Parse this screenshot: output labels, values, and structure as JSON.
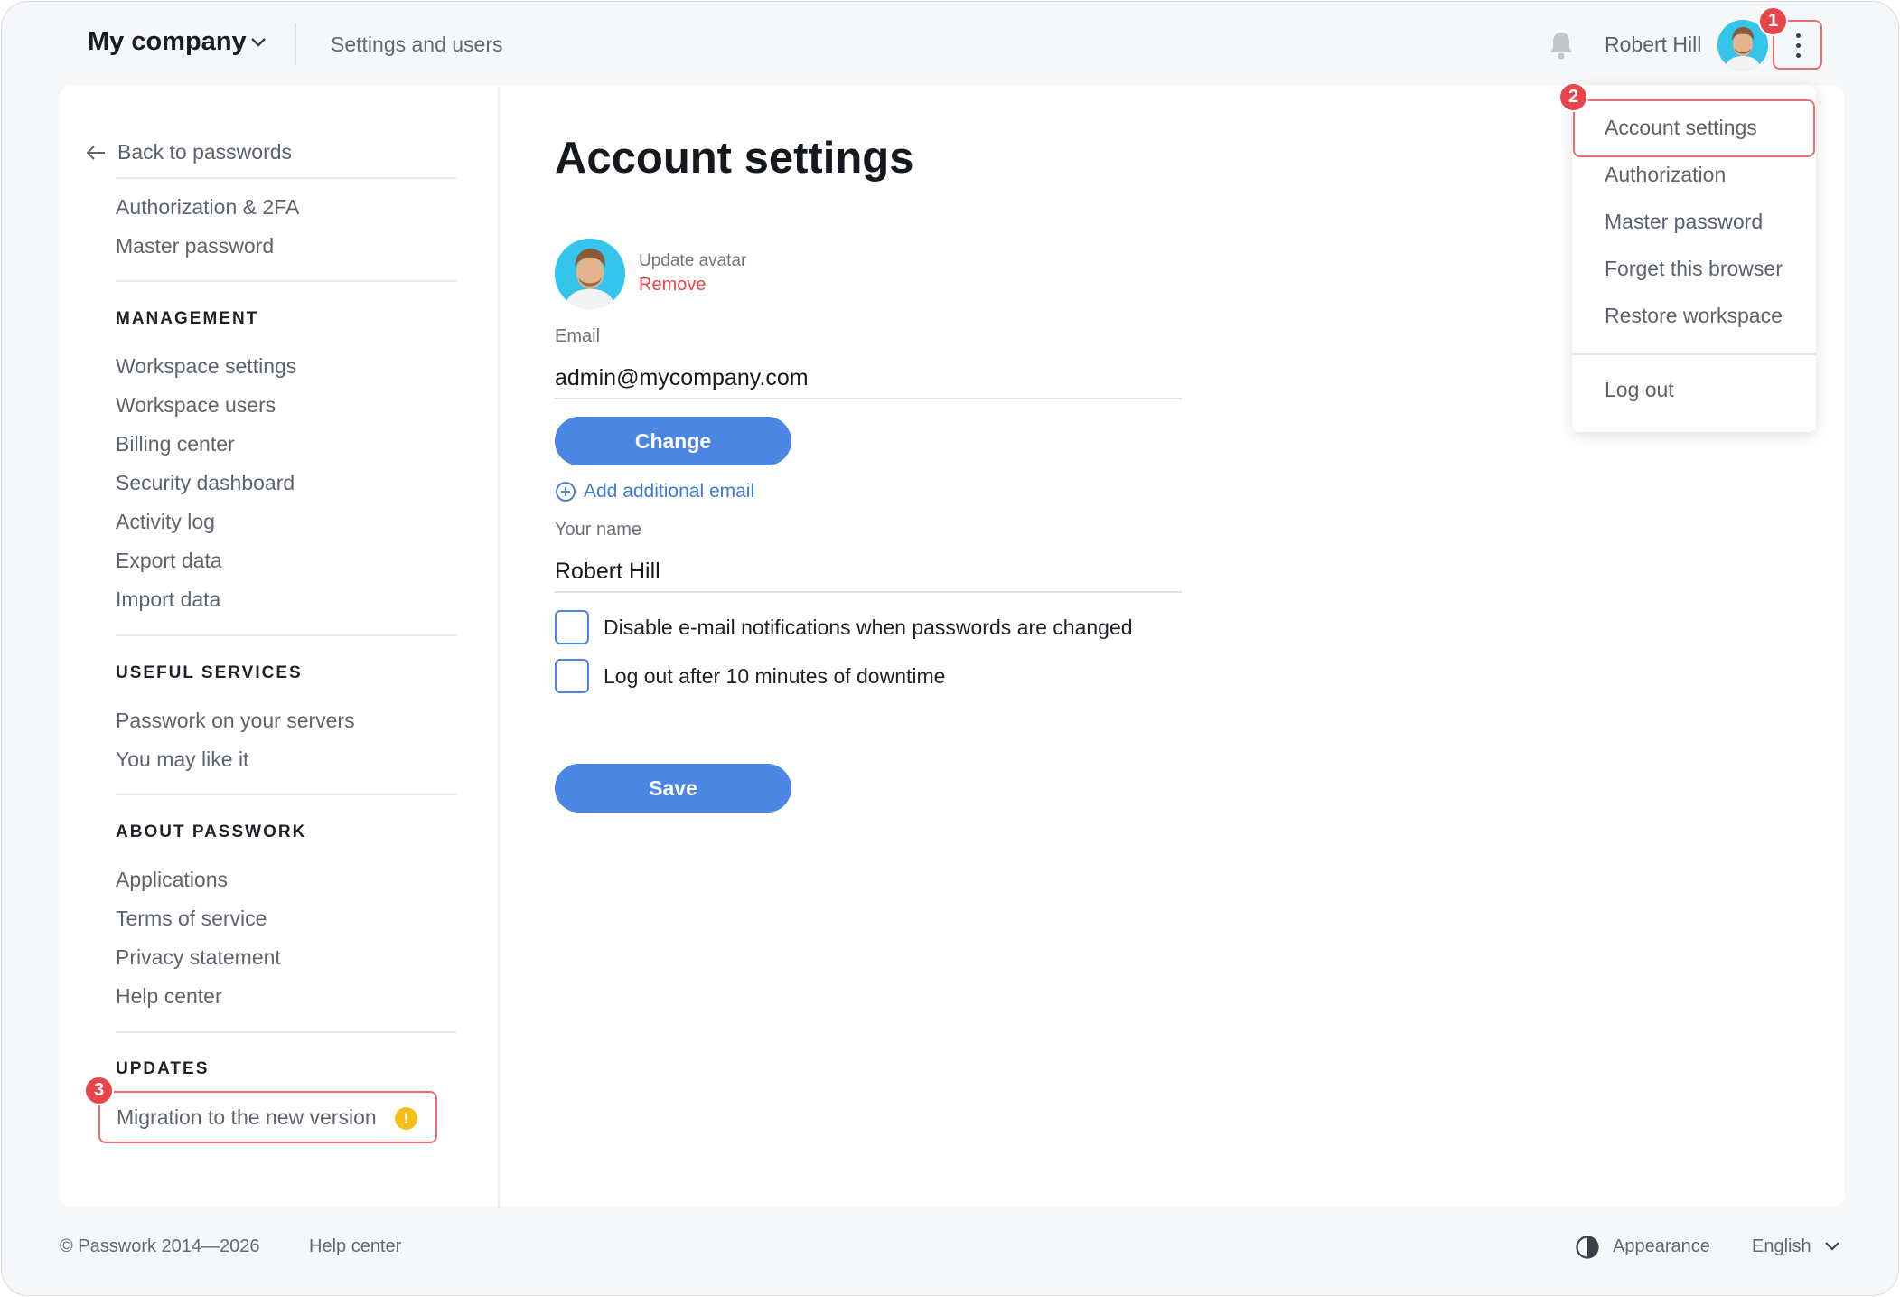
{
  "header": {
    "company": "My company",
    "breadcrumb": "Settings and users",
    "user_name": "Robert Hill"
  },
  "badges": {
    "one": "1",
    "two": "2",
    "three": "3"
  },
  "sidebar": {
    "back": "Back to passwords",
    "account_items": [
      "Authorization & 2FA",
      "Master password"
    ],
    "management_heading": "MANAGEMENT",
    "management_items": [
      "Workspace settings",
      "Workspace users",
      "Billing center",
      "Security dashboard",
      "Activity log",
      "Export data",
      "Import data"
    ],
    "services_heading": "USEFUL SERVICES",
    "services_items": [
      "Passwork on your servers",
      "You may like it"
    ],
    "about_heading": "ABOUT PASSWORK",
    "about_items": [
      "Applications",
      "Terms of service",
      "Privacy statement",
      "Help center"
    ],
    "updates_heading": "UPDATES",
    "migration": "Migration to the new version",
    "warning_glyph": "!"
  },
  "content": {
    "title": "Account settings",
    "update_avatar": "Update avatar",
    "remove": "Remove",
    "email_label": "Email",
    "email_value": "admin@mycompany.com",
    "change_button": "Change",
    "add_email": "Add additional email",
    "name_label": "Your name",
    "name_value": "Robert Hill",
    "checkbox_notifications": "Disable e-mail notifications when passwords are changed",
    "checkbox_logout": "Log out after 10 minutes of downtime",
    "save_button": "Save"
  },
  "menu": {
    "items": [
      "Account settings",
      "Authorization",
      "Master password",
      "Forget this browser",
      "Restore workspace"
    ],
    "logout": "Log out"
  },
  "footer": {
    "copyright": "© Passwork 2014—2026",
    "help": "Help center",
    "appearance": "Appearance",
    "language": "English"
  },
  "colors": {
    "accent": "#4a86e2",
    "highlight": "#ea6e6e",
    "danger": "#e8444b",
    "warning": "#f4bf1d"
  }
}
